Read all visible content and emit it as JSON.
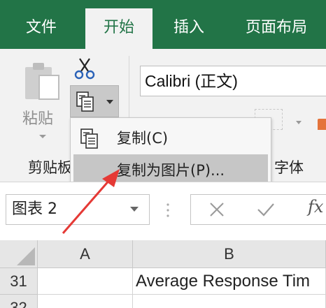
{
  "tabs": [
    {
      "label": "文件",
      "active": false
    },
    {
      "label": "开始",
      "active": true
    },
    {
      "label": "插入",
      "active": false
    },
    {
      "label": "页面布局",
      "active": false
    }
  ],
  "ribbon": {
    "paste_label": "粘贴",
    "clipboard_group_label": "剪贴板",
    "font_group_label": "字体",
    "font_name": "Calibri (正文)",
    "icons": [
      "paste-icon",
      "scissors-icon",
      "copy-icon"
    ]
  },
  "copy_menu": {
    "items": [
      {
        "label": "复制(C)",
        "icon": "copy-icon",
        "highlighted": false
      },
      {
        "label": "复制为图片(P)...",
        "icon": "",
        "highlighted": true
      }
    ]
  },
  "formula_bar": {
    "name_box": "图表 2",
    "cancel_icon": "x-icon",
    "enter_icon": "check-icon",
    "fx_label": "fx"
  },
  "grid": {
    "columns": [
      "A",
      "B"
    ],
    "rows": [
      {
        "number": "31",
        "cells": [
          "",
          "Average Response Tim"
        ]
      },
      {
        "number": "32",
        "cells": [
          "",
          ""
        ]
      }
    ]
  },
  "colors": {
    "brand_green": "#227447",
    "annotation_red": "#e53935"
  }
}
